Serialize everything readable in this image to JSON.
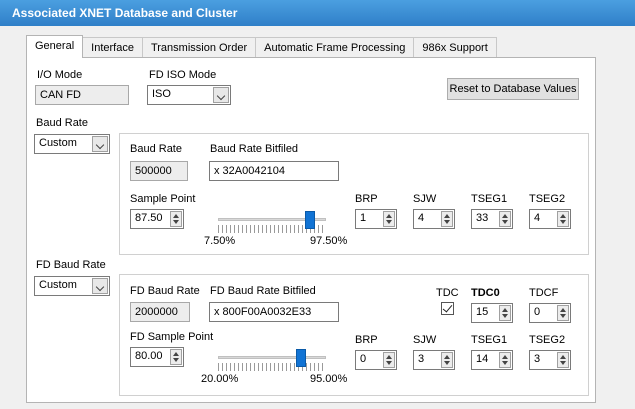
{
  "window": {
    "title": "Associated XNET Database and Cluster"
  },
  "tabs": [
    "General",
    "Interface",
    "Transmission Order",
    "Automatic Frame Processing",
    "986x Support"
  ],
  "general": {
    "io_mode_label": "I/O Mode",
    "io_mode_value": "CAN FD",
    "fd_iso_mode_label": "FD ISO Mode",
    "fd_iso_mode_value": "ISO",
    "reset_button": "Reset to Database Values"
  },
  "baud": {
    "section_label": "Baud Rate",
    "mode_value": "Custom",
    "baud_rate_label": "Baud Rate",
    "baud_rate_value": "500000",
    "bitfield_label": "Baud Rate Bitfiled",
    "bitfield_value": "x 32A0042104",
    "sample_point_label": "Sample Point",
    "sample_point_value": "87.50",
    "slider_min": "7.50%",
    "slider_max": "97.50%",
    "slider_fraction": 0.89,
    "brp_label": "BRP",
    "brp_value": "1",
    "sjw_label": "SJW",
    "sjw_value": "4",
    "tseg1_label": "TSEG1",
    "tseg1_value": "33",
    "tseg2_label": "TSEG2",
    "tseg2_value": "4"
  },
  "fd_baud": {
    "section_label": "FD Baud Rate",
    "mode_value": "Custom",
    "baud_rate_label": "FD Baud Rate",
    "baud_rate_value": "2000000",
    "bitfield_label": "FD Baud Rate Bitfiled",
    "bitfield_value": "x 800F00A0032E33",
    "sample_point_label": "FD Sample Point",
    "sample_point_value": "80.00",
    "slider_min": "20.00%",
    "slider_max": "95.00%",
    "slider_fraction": 0.8,
    "tdc_label": "TDC",
    "tdc_checked": true,
    "tdco_label": "TDC0",
    "tdco_value": "15",
    "tdcf_label": "TDCF",
    "tdcf_value": "0",
    "brp_label": "BRP",
    "brp_value": "0",
    "sjw_label": "SJW",
    "sjw_value": "3",
    "tseg1_label": "TSEG1",
    "tseg1_value": "14",
    "tseg2_label": "TSEG2",
    "tseg2_value": "3"
  }
}
